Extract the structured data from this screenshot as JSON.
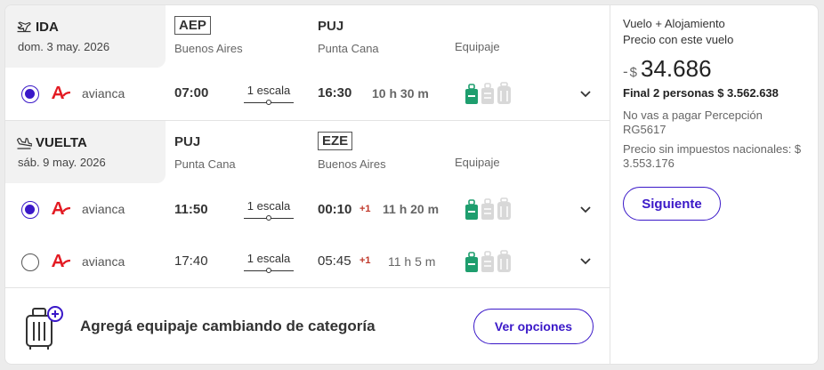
{
  "outbound": {
    "label": "IDA",
    "date": "dom. 3 may. 2026",
    "origin_code": "AEP",
    "origin_city": "Buenos Aires",
    "dest_code": "PUJ",
    "dest_city": "Punta Cana",
    "equipment_label": "Equipaje",
    "flights": [
      {
        "selected": true,
        "airline": "avianca",
        "depart": "07:00",
        "stops": "1 escala",
        "arrive": "16:30",
        "plus_day": "",
        "duration": "10 h 30 m"
      }
    ]
  },
  "return": {
    "label": "VUELTA",
    "date": "sáb. 9 may. 2026",
    "origin_code": "PUJ",
    "origin_city": "Punta Cana",
    "dest_code": "EZE",
    "dest_city": "Buenos Aires",
    "equipment_label": "Equipaje",
    "flights": [
      {
        "selected": true,
        "airline": "avianca",
        "depart": "11:50",
        "stops": "1 escala",
        "arrive": "00:10",
        "plus_day": "+1",
        "duration": "11 h 20 m"
      },
      {
        "selected": false,
        "airline": "avianca",
        "depart": "17:40",
        "stops": "1 escala",
        "arrive": "05:45",
        "plus_day": "+1",
        "duration": "11 h 5 m"
      }
    ]
  },
  "promo": {
    "text": "Agregá equipaje cambiando de categoría",
    "button": "Ver opciones"
  },
  "summary": {
    "title": "Vuelo + Alojamiento",
    "subtitle": "Precio con este vuelo",
    "sign": "-",
    "currency": "$",
    "price": "34.686",
    "total": "Final 2 personas  $ 3.562.638",
    "perception": "No vas a pagar Percepción RG5617",
    "no_tax": "Precio sin impuestos nacionales: $ 3.553.176",
    "button": "Siguiente"
  },
  "colors": {
    "accent": "#3a18c8",
    "bag_included": "#1e9e6e",
    "bag_excluded": "#d8d8d8",
    "airline": "#e31b23"
  },
  "icons": {
    "outbound": "plane-takeoff-icon",
    "return": "plane-landing-icon",
    "expand": "chevron-down-icon",
    "promo": "luggage-plus-icon"
  }
}
